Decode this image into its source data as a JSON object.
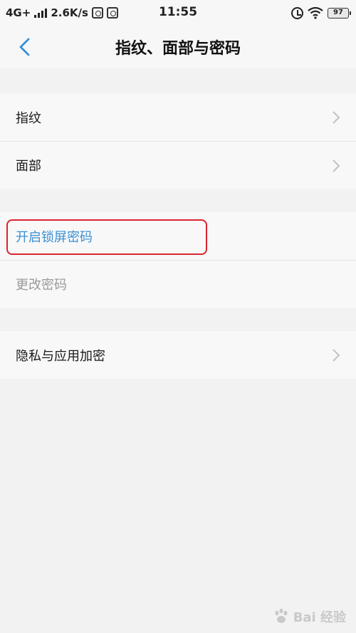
{
  "status_bar": {
    "network": "4G+",
    "speed": "2.6K/s",
    "time": "11:55",
    "battery": "97"
  },
  "header": {
    "title": "指纹、面部与密码"
  },
  "sections": {
    "biometrics": {
      "fingerprint": "指纹",
      "face": "面部"
    },
    "password": {
      "enable_lock_password": "开启锁屏密码",
      "change_password": "更改密码"
    },
    "privacy": {
      "privacy_app_encryption": "隐私与应用加密"
    }
  },
  "colors": {
    "accent": "#3a90d4",
    "highlight": "#d9242f",
    "disabled_text": "#9a9a9a",
    "background": "#f2f2f2"
  },
  "watermark": {
    "text": "Bai 经验"
  }
}
